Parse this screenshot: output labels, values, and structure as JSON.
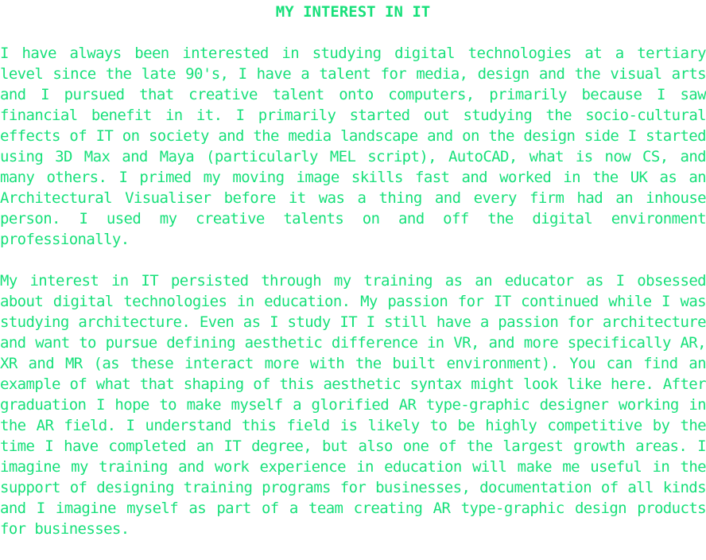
{
  "document": {
    "title": "MY INTEREST IN IT",
    "paragraphs": [
      "I have always been interested in studying digital technologies at a tertiary level since the late 90's, I have a talent for media, design and the visual arts and I pursued that creative talent onto computers, primarily because I saw financial benefit in it. I primarily started out studying the socio-cultural effects of IT on society and the media landscape and on the design side I started using 3D Max and Maya (particularly MEL script), AutoCAD, what is now CS, and many others. I primed my moving image skills fast and worked in the UK as an Architectural Visualiser before it was a thing and every firm had an inhouse person. I used my creative talents on and off the digital environment professionally.",
      "My interest in IT persisted through my training as an educator as I obsessed about digital technologies in education. My passion for IT continued while I was studying architecture. Even as I study IT I still have a passion for architecture and want to pursue defining aesthetic difference in VR, and more specifically AR, XR and MR (as these interact more with the built environment). You can find an example of what that shaping of this aesthetic syntax might look like here. After graduation I hope to make myself a glorified AR type-graphic designer working in the AR field. I understand this field is likely to be highly competitive by the time I have completed an IT degree, but also one of the largest growth areas. I imagine my training and work experience in education will make me useful in the support of designing training programs for businesses, documentation of all kinds and I imagine myself as part of a team creating AR type-graphic design products for businesses."
    ]
  },
  "colors": {
    "text": "#17e07a",
    "background": "#ffffff"
  }
}
